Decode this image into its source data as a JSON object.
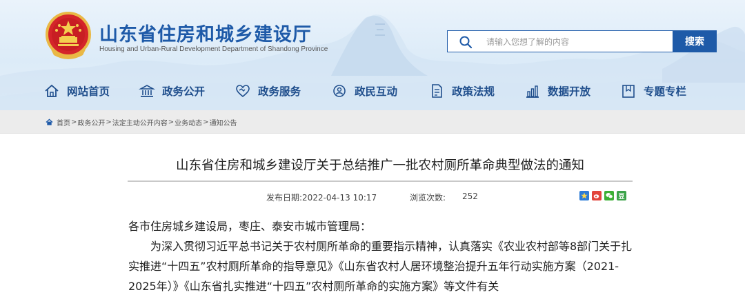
{
  "header": {
    "title": "山东省住房和城乡建设厅",
    "subtitle": "Housing and Urban-Rural Development Department of Shandong Province",
    "search": {
      "placeholder": "请输入您想了解的内容",
      "button_label": "搜索"
    },
    "colors": {
      "brand_blue": "#1e5aa8",
      "nav_text": "#1f4e8c"
    }
  },
  "nav": {
    "items": [
      {
        "label": "网站首页",
        "icon": "home-icon"
      },
      {
        "label": "政务公开",
        "icon": "building-icon"
      },
      {
        "label": "政务服务",
        "icon": "handshake-icon"
      },
      {
        "label": "政民互动",
        "icon": "interaction-icon"
      },
      {
        "label": "政策法规",
        "icon": "document-icon"
      },
      {
        "label": "数据开放",
        "icon": "bar-chart-icon"
      },
      {
        "label": "专题专栏",
        "icon": "bookmark-icon"
      }
    ]
  },
  "breadcrumb": {
    "items": [
      "首页",
      "政务公开",
      "法定主动公开内容",
      "业务动态",
      "通知公告"
    ],
    "separator": ">"
  },
  "article": {
    "title": "山东省住房和城乡建设厅关于总结推广一批农村厕所革命典型做法的通知",
    "publish_label": "发布日期:2022-04-13 10:17",
    "views_label": "浏览次数:",
    "views_value": "252",
    "salutation": "各市住房城乡建设局，枣庄、泰安市城市管理局：",
    "paragraph_1": "为深入贯彻习近平总书记关于农村厕所革命的重要指示精神，认真落实《农业农村部等8部门关于扎实推进“十四五”农村厕所革命的指导意见》《山东省农村人居环境整治提升五年行动实施方案（2021-2025年）》《山东省扎实推进“十四五”农村厕所革命的实施方案》等文件有关"
  },
  "share": {
    "icons": [
      "share-qzone-icon",
      "share-weibo-icon",
      "share-wechat-icon",
      "share-douban-icon"
    ],
    "labels": [
      "",
      "",
      "",
      "豆"
    ],
    "colors": [
      "#2b7bd6",
      "#e2453c",
      "#3cb035",
      "#3ca34a"
    ]
  }
}
